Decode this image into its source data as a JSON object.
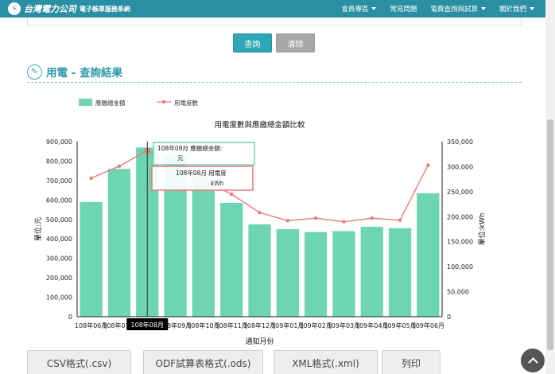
{
  "header": {
    "logo_text": "台灣電力公司",
    "logo_sub": "電子帳單服務系統",
    "nav": [
      {
        "label": "會員專區",
        "has_caret": true
      },
      {
        "label": "常見問題",
        "has_caret": false
      },
      {
        "label": "電費查詢與試算",
        "has_caret": true
      },
      {
        "label": "關於我們",
        "has_caret": true
      }
    ]
  },
  "form": {
    "query_label": "查詢",
    "clear_label": "清除"
  },
  "section": {
    "title": "用電 - 查詢結果"
  },
  "chart_data": {
    "type": "bar",
    "title": "用電度數與應繳總金額比較",
    "xlabel": "通知月份",
    "ylabel": "單位:元",
    "y2label": "單位:kWh",
    "ylim": [
      0,
      900000
    ],
    "y2lim": [
      0,
      350000
    ],
    "yticks": [
      "0",
      "100,000",
      "200,000",
      "300,000",
      "400,000",
      "500,000",
      "600,000",
      "700,000",
      "800,000",
      "900,000"
    ],
    "y2ticks": [
      "0",
      "50,000",
      "100,000",
      "150,000",
      "200,000",
      "250,000",
      "300,000",
      "350,000"
    ],
    "categories": [
      "108年06月",
      "108年07月",
      "108年08月",
      "108年09月",
      "108年10月",
      "108年11月",
      "108年12月",
      "109年01月",
      "109年02月",
      "109年03月",
      "109年04月",
      "109年05月",
      "109年06月"
    ],
    "series": [
      {
        "name": "應繳總金額",
        "type": "bar",
        "color": "#6dd5b0",
        "values": [
          590000,
          760000,
          870000,
          830000,
          740000,
          585000,
          475000,
          450000,
          435000,
          440000,
          462000,
          455000,
          635000
        ]
      },
      {
        "name": "用電度數",
        "type": "line",
        "axis": "right",
        "color": "#e87979",
        "values": [
          277000,
          301000,
          332000,
          290000,
          272000,
          245000,
          208000,
          192000,
          197000,
          190000,
          197000,
          193000,
          303000
        ]
      }
    ],
    "legend_position": "top-left",
    "grid": false
  },
  "tooltip": {
    "category_label": "108年08月",
    "bar_line": "108年08月 應繳總金額:",
    "bar_unit": "元",
    "line_line": "108年08月 用電度",
    "line_unit": "kWh"
  },
  "exports": [
    {
      "label": "CSV格式(.csv)"
    },
    {
      "label": "ODF試算表格式(.ods)"
    },
    {
      "label": "XML格式(.xml)"
    },
    {
      "label": "列印"
    }
  ]
}
